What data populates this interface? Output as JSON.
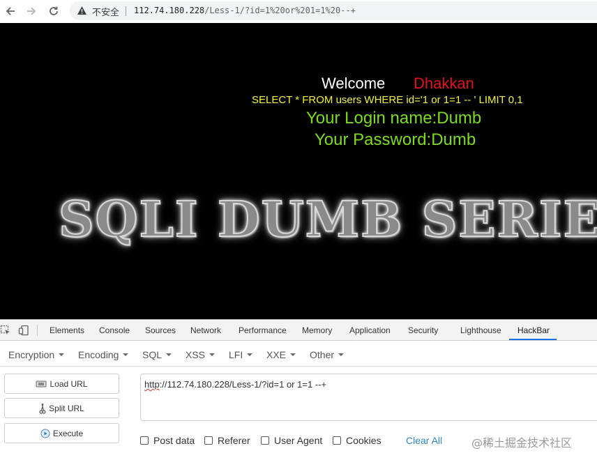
{
  "browser": {
    "security_label": "不安全",
    "address_host": "112.74.180.228",
    "address_path": "/Less-1/?id=1%20or%201=1%20--+"
  },
  "page": {
    "welcome": "Welcome",
    "user": "Dhakkan",
    "query": "SELECT * FROM users WHERE id='1 or 1=1 -- ' LIMIT 0,1",
    "login_name": "Your Login name:Dumb",
    "password": "Your Password:Dumb",
    "banner": "SQLI DUMB SERIES"
  },
  "devtools": {
    "tabs": [
      "Elements",
      "Console",
      "Sources",
      "Network",
      "Performance",
      "Memory",
      "Application",
      "Security",
      "Lighthouse",
      "HackBar"
    ],
    "active_tab": "HackBar"
  },
  "hackbar": {
    "menu": [
      "Encryption",
      "Encoding",
      "SQL",
      "XSS",
      "LFI",
      "XXE",
      "Other"
    ],
    "buttons": {
      "load": "Load URL",
      "split": "Split URL",
      "execute": "Execute"
    },
    "url_value_prefix": "http",
    "url_value_rest": "://112.74.180.228/Less-1/?id=1 or 1=1 --+",
    "options": {
      "post": "Post data",
      "referer": "Referer",
      "user_agent": "User Agent",
      "cookies": "Cookies"
    },
    "clear_all": "Clear All"
  },
  "watermark": "@稀土掘金技术社区",
  "colors": {
    "welcome_name": "#e0141e",
    "query": "#f5f53c",
    "login_text": "#7ddc1f",
    "link": "#2f86c9",
    "active_tab_underline": "#1a73e8"
  }
}
